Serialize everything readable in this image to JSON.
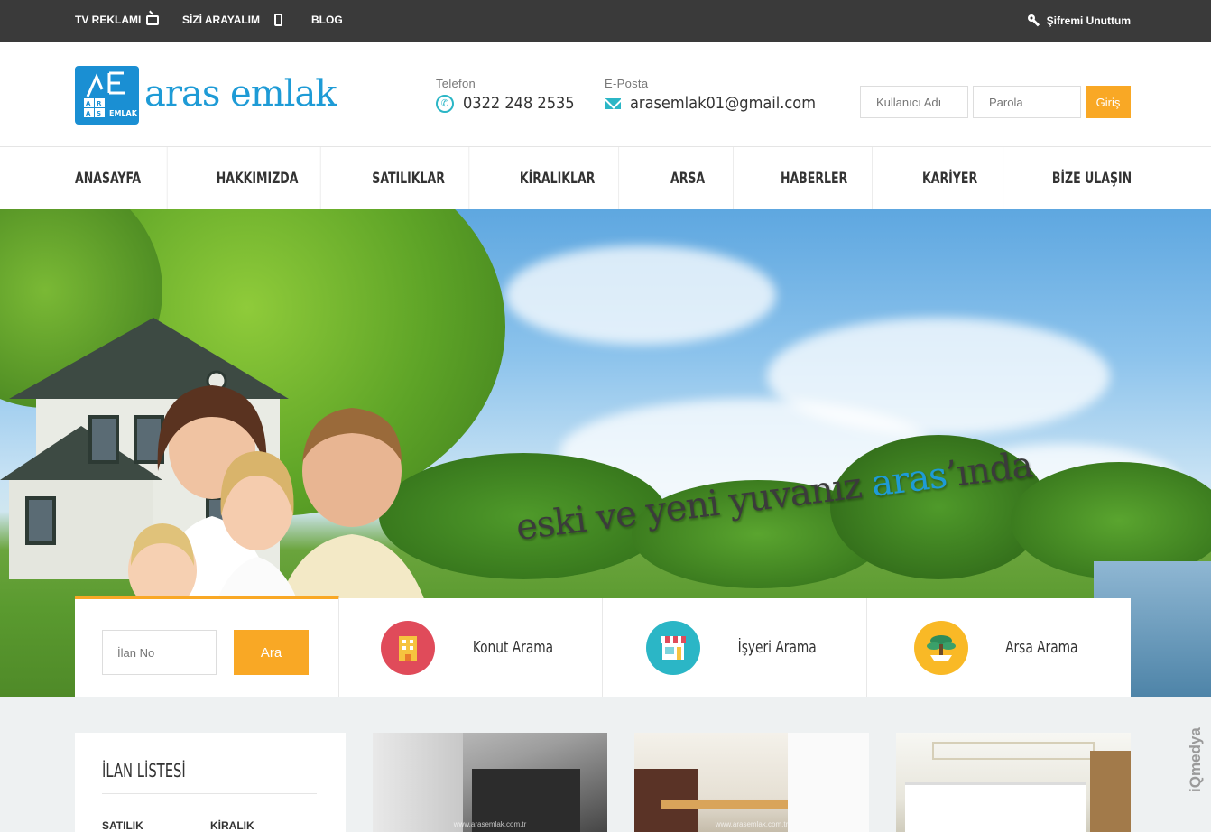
{
  "topbar": {
    "tv_label": "TV REKLAMI",
    "call_label": "SİZİ ARAYALIM",
    "blog_label": "BLOG",
    "forgot_label": "Şifremi Unuttum"
  },
  "header": {
    "logo_text": "aras emlak",
    "phone_label": "Telefon",
    "phone_value": "0322 248 2535",
    "email_label": "E-Posta",
    "email_value": "arasemlak01@gmail.com",
    "username_placeholder": "Kullanıcı Adı",
    "password_placeholder": "Parola",
    "login_button": "Giriş"
  },
  "nav": {
    "items": [
      "ANASAYFA",
      "HAKKIMIZDA",
      "SATILIKLAR",
      "KİRALIKLAR",
      "ARSA",
      "HABERLER",
      "KARİYER",
      "BİZE ULAŞIN"
    ]
  },
  "hero": {
    "slogan_pre": "eski ve yeni yuvanız ",
    "slogan_highlight": "aras",
    "slogan_post": "’ında"
  },
  "search": {
    "listing_placeholder": "İlan No",
    "search_button": "Ara",
    "categories": [
      "Konut Arama",
      "İşyeri Arama",
      "Arsa Arama"
    ],
    "category_colors": [
      "#e04b5a",
      "#2bb6c6",
      "#f9b926"
    ]
  },
  "sidebar": {
    "title": "İLAN LİSTESİ",
    "tab_sale": "SATILIK",
    "tab_rent": "KİRALIK"
  },
  "cards": {
    "watermark": "www.arasemlak.com.tr"
  },
  "brand": {
    "accent": "#f9a825",
    "primary": "#1e9bd6",
    "teal": "#2bb6c6"
  }
}
